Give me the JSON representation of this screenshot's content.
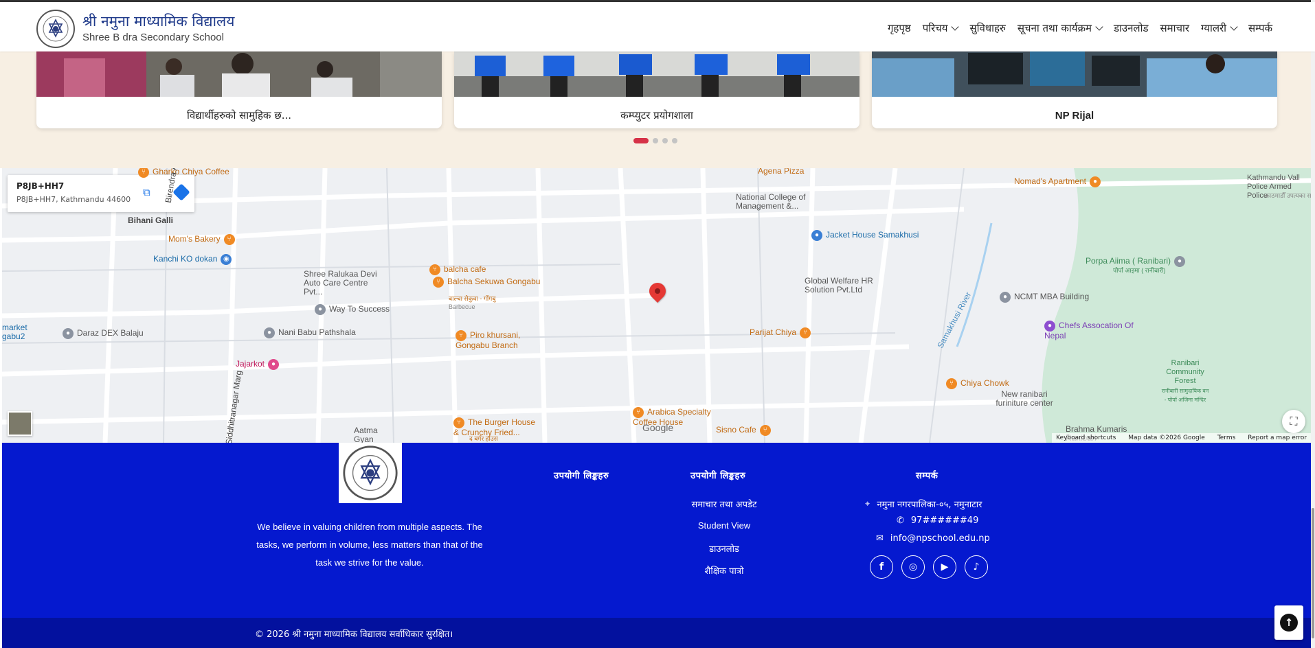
{
  "header": {
    "title": "श्री नमुना माध्यामिक विद्यालय",
    "subtitle": "Shree B dra Secondary School",
    "nav": [
      {
        "label": "गृहपृष्ठ",
        "dropdown": false
      },
      {
        "label": "परिचय",
        "dropdown": true
      },
      {
        "label": "सुविधाहरु",
        "dropdown": false
      },
      {
        "label": "सूचना तथा कार्यक्रम",
        "dropdown": true
      },
      {
        "label": "डाउनलोड",
        "dropdown": false
      },
      {
        "label": "समाचार",
        "dropdown": false
      },
      {
        "label": "ग्यालरी",
        "dropdown": true
      },
      {
        "label": "सम्पर्क",
        "dropdown": false
      }
    ]
  },
  "gallery": {
    "cards": [
      {
        "caption": "विद्यार्थीहरुको सामुहिक छ..."
      },
      {
        "caption": "कम्प्युटर प्रयोगशाला"
      },
      {
        "caption": "NP Rijal"
      }
    ],
    "dots_count": 4,
    "active_dot": 1
  },
  "map": {
    "plus_code": "P8JB+HH7",
    "address": "P8JB+HH7, Kathmandu 44600",
    "places": [
      "Gharko Chiya Coffee",
      "Bihani Galli",
      "Mom's Bakery",
      "Kanchi KO dokan",
      "Shree Ralukaa Devi Auto Care Centre Pvt...",
      "balcha cafe",
      "Balcha Sekuwa Gongabu",
      "बाल्चा सेकुवा - गोंगबु",
      "Barbecue",
      "Way To Success",
      "Nani Babu Pathshala",
      "Daraz DEX Balaju",
      "market gabu2",
      "Jajarkot",
      "Piro khursani, Gongabu Branch",
      "Agena Pizza",
      "National College of Management &...",
      "Jacket House Samakhusi",
      "Global Welfare HR Solution Pvt.Ltd",
      "Parijat Chiya",
      "Nomad's Apartment",
      "Kathmandu Vall Police Armed Police",
      "काठमाडौँ उपत्यका सशस्त्र",
      "Porpa Aiima ( Ranibari)",
      "पोर्पा आइमा ( रानीबारी)",
      "NCMT MBA Building",
      "Chefs Assocation Of Nepal",
      "Samakhusi River",
      "Ranibari Community Forest",
      "रानीबारी सामुदायिक वन - पोर्पा अजिमा मन्दिर",
      "Chiya Chowk",
      "New ranibari furiniture center",
      "Arabica Specialty Coffee House",
      "Sisno Cafe",
      "The Burger House & Crunchy Fried...",
      "द बर्गर हाउस",
      "Aatma Gyan Prachar Sam",
      "Brahma Kumaris Ranibari",
      "Birendra Aishwarya",
      "Siddhitranagar Marg"
    ],
    "google_label": "Google",
    "attribution": [
      "Keyboard shortcuts",
      "Map data ©2026 Google",
      "Terms",
      "Report a map error"
    ]
  },
  "footer": {
    "description": "We believe in valuing children from multiple aspects. The tasks, we perform in volume, less matters than that of the task we strive for the value.",
    "col1_heading": "उपयोगी लिङ्कहरु",
    "col2_heading": "उपयोगी लिङ्कहरु",
    "col2_links": [
      "समाचार तथा अपडेट",
      "Student View",
      "डाउनलोड",
      "शैक्षिक पात्रो"
    ],
    "contact_heading": "सम्पर्क",
    "address": "नमुना नगरपालिका-०५, नमुनाटार",
    "phone": "97######49",
    "email": "info@npschool.edu.np",
    "social": [
      "facebook",
      "instagram",
      "youtube",
      "tiktok"
    ],
    "copyright": "© 2026 श्री नमुना माध्यामिक विद्यालय सर्वाधिकार सुरक्षित।"
  }
}
